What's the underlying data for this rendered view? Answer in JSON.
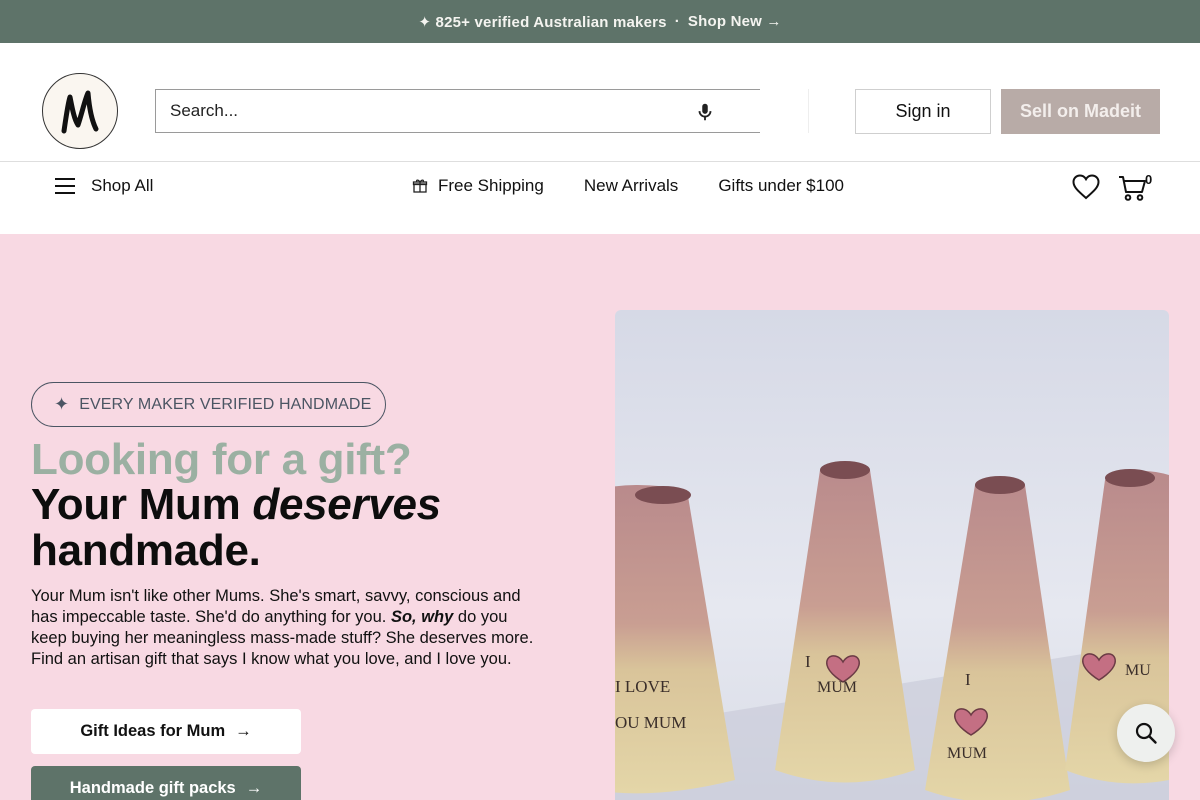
{
  "announcement": {
    "text": "✦ 825+ verified Australian makers",
    "separator": "·",
    "link": "Shop New →",
    "bg": "#5e7369"
  },
  "header": {
    "logo_text": "m",
    "search_placeholder": "Search...",
    "signin_label": "Sign in",
    "sell_label": "Sell on Madeit",
    "sell_bg": "#b8aba7"
  },
  "nav": {
    "shop_all": "Shop All",
    "links": [
      "Free Shipping",
      "New Arrivals",
      "Gifts under $100"
    ],
    "cart_count": "0"
  },
  "hero": {
    "bg": "#f8d9e3",
    "badge_icon": "sparkle-icon",
    "badge": "EVERY MAKER VERIFIED HANDMADE",
    "headline_small": "Looking for a gift?",
    "headline_1": "Your Mum ",
    "headline_em": "deserves",
    "headline_2": "handmade.",
    "blurb_1": "Your Mum isn't like other Mums. She's smart, savvy, conscious and has impeccable taste. She'd do anything for you. ",
    "blurb_em": "So, why",
    "blurb_2": " do you keep buying her meaningless mass-made stuff? She deserves more. Find an artisan gift that says I know what you love, and I love you.",
    "btn_primary": "Gift Ideas for Mum",
    "btn_secondary": "Handmade gift packs",
    "btn_arrow": "→",
    "photo_vase_texts": [
      "I LOVE",
      "OU MUM",
      "I",
      "MUM",
      "I",
      "MUM",
      "MU"
    ]
  },
  "colors": {
    "accent": "#5e7369",
    "headline_muted": "#9bb0a2"
  }
}
